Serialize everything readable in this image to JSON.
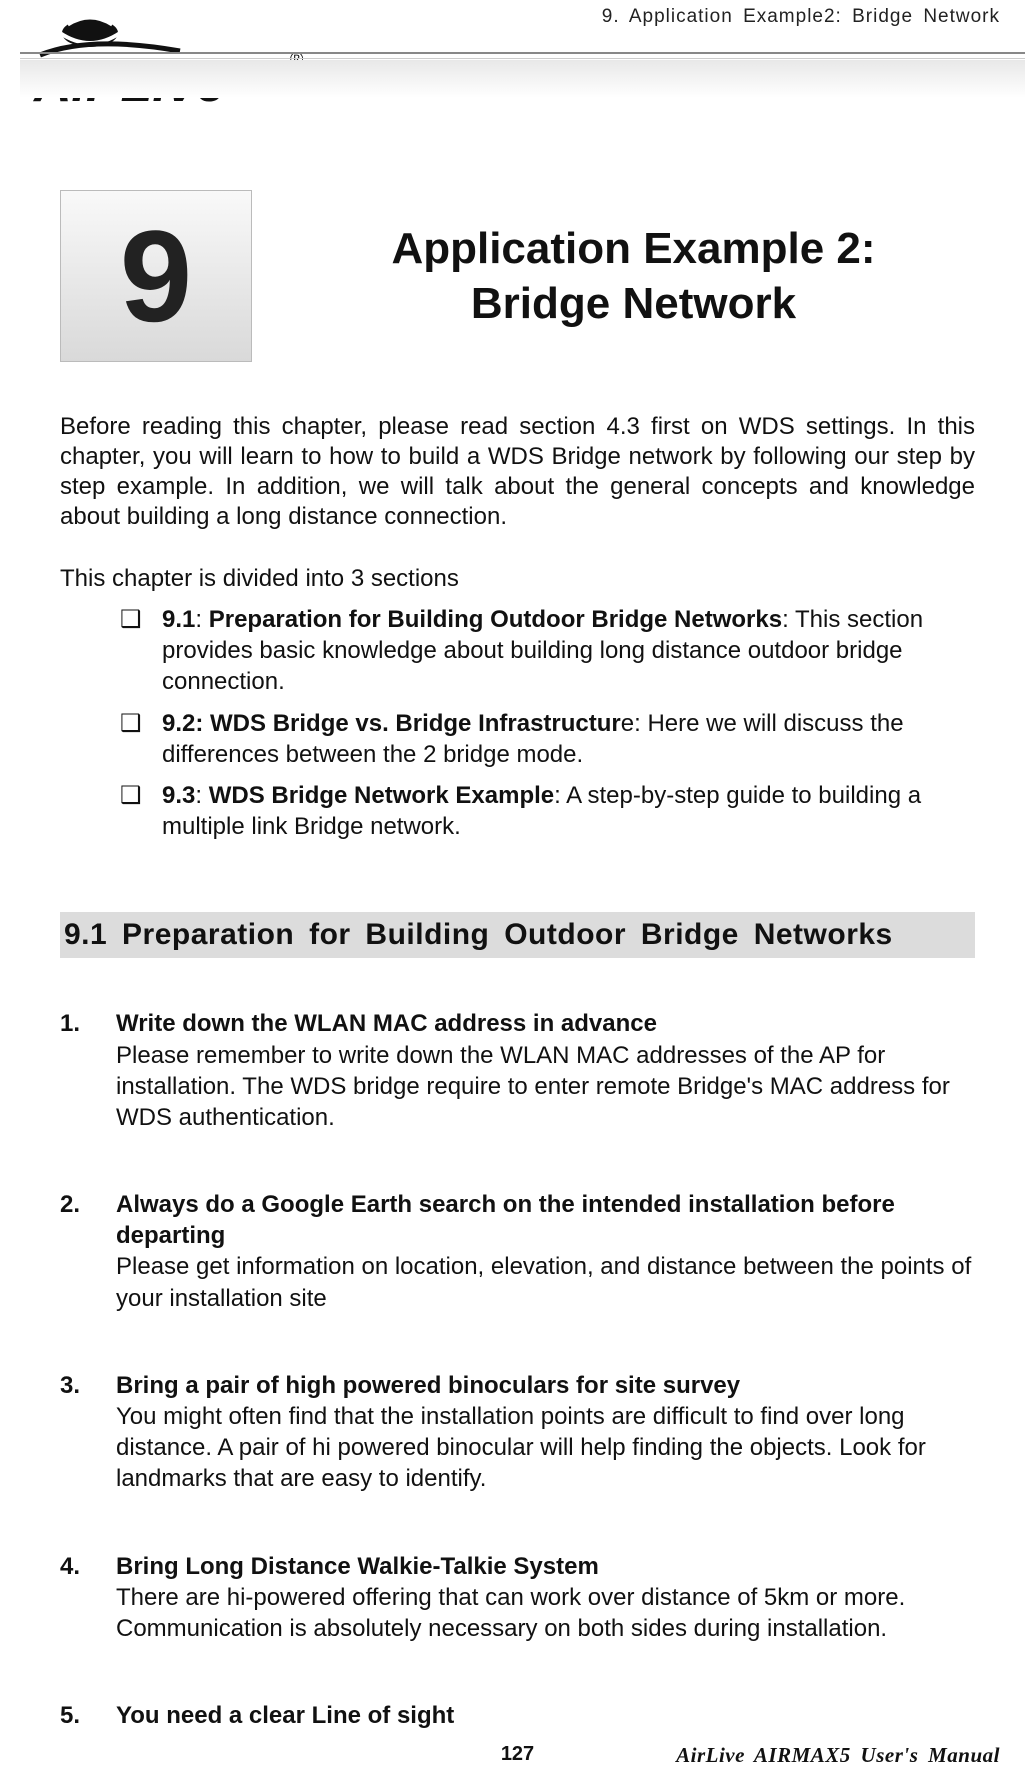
{
  "header": {
    "running_title": "9. Application Example2: Bridge Network",
    "logo_text": "Air Live",
    "logo_r": "®"
  },
  "chapter": {
    "number": "9",
    "title_line1": "Application Example 2:",
    "title_line2": "Bridge Network"
  },
  "intro": "Before reading this chapter, please read section 4.3 first on WDS settings.    In this chapter, you will learn to how to build a WDS Bridge network by following our step by step example.  In addition, we will talk about the general concepts and knowledge about building a long distance connection.",
  "subintro": "This chapter is divided into 3 sections",
  "outline": [
    {
      "ref": "9.1",
      "bold": "Preparation for Building Outdoor Bridge Networks",
      "rest": ": This section provides basic knowledge about building long distance outdoor bridge connection."
    },
    {
      "ref": "9.2:",
      "bold": "WDS Bridge vs. Bridge Infrastructur",
      "boldtrail": "e",
      "rest": ":    Here we will discuss the differences between the 2 bridge mode."
    },
    {
      "ref": "9.3",
      "bold": "WDS Bridge Network Example",
      "rest": ":    A step-by-step guide to building a multiple link Bridge network."
    }
  ],
  "section91": {
    "heading": "9.1 Preparation for Building Outdoor Bridge Networks",
    "items": [
      {
        "n": "1.",
        "title": "Write down the WLAN MAC address in advance",
        "desc": "Please remember to write down the WLAN MAC addresses of the AP for installation.  The WDS bridge require to enter remote Bridge's MAC address for WDS authentication."
      },
      {
        "n": "2.",
        "title": "Always do a Google Earth search on the intended installation before departing",
        "desc": "Please get information on location, elevation, and distance between the points of your installation site"
      },
      {
        "n": "3.",
        "title": "Bring a pair of high powered binoculars for site survey",
        "desc": "You might often find that the installation points are difficult to find over long distance.  A pair of hi powered binocular will help finding the objects.    Look for landmarks that are easy to identify."
      },
      {
        "n": "4.",
        "title": "Bring Long Distance Walkie-Talkie System",
        "desc": "There are hi-powered offering that can work over distance of 5km or more.  Communication is absolutely necessary on both sides during installation."
      },
      {
        "n": "5.",
        "title": "You need a clear Line of sight",
        "desc": ""
      }
    ]
  },
  "footer": {
    "page": "127",
    "right": "AirLive AIRMAX5 User's Manual"
  }
}
